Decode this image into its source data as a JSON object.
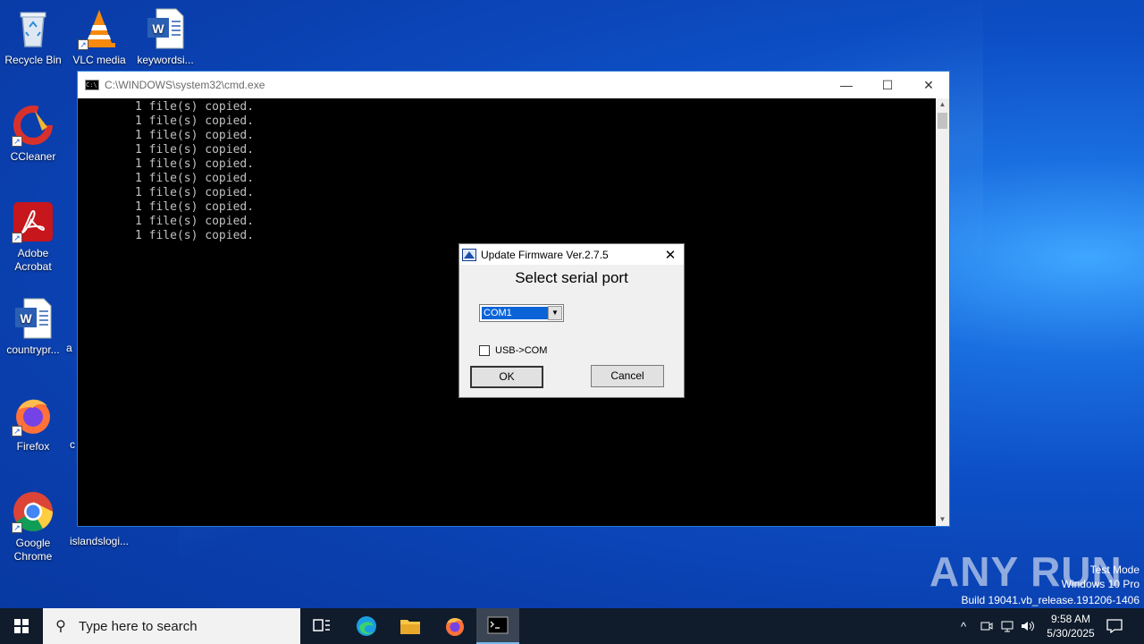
{
  "desktop": {
    "icons": [
      {
        "label": "Recycle Bin",
        "icon": "recycle-bin-icon"
      },
      {
        "label": "VLC media",
        "icon": "vlc-icon"
      },
      {
        "label": "keywordsi...",
        "icon": "word-document-icon"
      },
      {
        "label": "CCleaner",
        "icon": "ccleaner-icon"
      },
      {
        "label": "Adobe Acrobat",
        "icon": "adobe-acrobat-icon"
      },
      {
        "label": "countrypr...",
        "icon": "word-document-icon"
      },
      {
        "label": "Firefox",
        "icon": "firefox-icon"
      },
      {
        "label": "Google Chrome",
        "icon": "chrome-icon"
      },
      {
        "label": "islandslogi...",
        "icon": "file-icon"
      },
      {
        "label": "a",
        "icon": "file-icon"
      },
      {
        "label": "c",
        "icon": "file-icon"
      }
    ]
  },
  "cmd": {
    "title": "C:\\WINDOWS\\system32\\cmd.exe",
    "minimize": "—",
    "maximize": "☐",
    "close": "✕",
    "lines": [
      "1 file(s) copied.",
      "1 file(s) copied.",
      "1 file(s) copied.",
      "1 file(s) copied.",
      "1 file(s) copied.",
      "1 file(s) copied.",
      "1 file(s) copied.",
      "1 file(s) copied.",
      "1 file(s) copied.",
      "1 file(s) copied."
    ]
  },
  "dialog": {
    "title": "Update Firmware Ver.2.7.5",
    "close": "✕",
    "heading": "Select serial port",
    "combo_value": "COM1",
    "checkbox_label": "USB->COM",
    "checkbox_checked": false,
    "ok_label": "OK",
    "cancel_label": "Cancel"
  },
  "taskbar": {
    "search_placeholder": "Type here to search",
    "time": "9:58 AM",
    "date": "5/30/2025",
    "pinned": [
      "task-view-icon",
      "edge-icon",
      "file-explorer-icon",
      "firefox-icon",
      "cmd-icon"
    ]
  },
  "watermark": {
    "brand": "ANY RUN",
    "line1": "Test Mode",
    "line2": "Windows 10 Pro",
    "line3": "Build 19041.vb_release.191206-1406"
  }
}
